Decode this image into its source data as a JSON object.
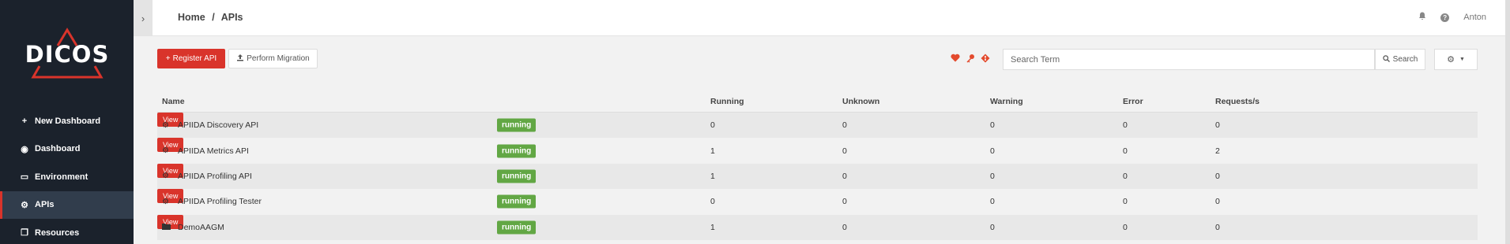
{
  "brand": {
    "name": "DICOS",
    "accent": "#d9342b"
  },
  "sidebar": {
    "items": [
      {
        "label": "New Dashboard",
        "icon": "plus-icon",
        "glyph": "+"
      },
      {
        "label": "Dashboard",
        "icon": "dashboard-icon",
        "glyph": "◉"
      },
      {
        "label": "Environment",
        "icon": "monitor-icon",
        "glyph": "▭"
      },
      {
        "label": "APIs",
        "icon": "cogs-icon",
        "glyph": "⚙"
      },
      {
        "label": "Resources",
        "icon": "copy-icon",
        "glyph": "❐"
      }
    ],
    "active_index": 3
  },
  "header": {
    "breadcrumb": {
      "home": "Home",
      "separator": "/",
      "current": "APIs"
    },
    "user": "Anton"
  },
  "toolbar": {
    "register_label": "Register API",
    "migration_label": "Perform Migration",
    "search_placeholder": "Search Term",
    "search_value": "",
    "search_label": "Search"
  },
  "table": {
    "headers": {
      "name": "Name",
      "running": "Running",
      "unknown": "Unknown",
      "warning": "Warning",
      "error": "Error",
      "requests": "Requests/s"
    },
    "rows": [
      {
        "name": "APIIDA Discovery API",
        "icon": "cogs-icon",
        "status": "running",
        "running": "0",
        "unknown": "0",
        "warning": "0",
        "error": "0",
        "requests": "0",
        "action": "View"
      },
      {
        "name": "APIIDA Metrics API",
        "icon": "cogs-icon",
        "status": "running",
        "running": "1",
        "unknown": "0",
        "warning": "0",
        "error": "0",
        "requests": "2",
        "action": "View"
      },
      {
        "name": "APIIDA Profiling API",
        "icon": "cogs-icon",
        "status": "running",
        "running": "1",
        "unknown": "0",
        "warning": "0",
        "error": "0",
        "requests": "0",
        "action": "View"
      },
      {
        "name": "APIIDA Profiling Tester",
        "icon": "cogs-icon",
        "status": "running",
        "running": "0",
        "unknown": "0",
        "warning": "0",
        "error": "0",
        "requests": "0",
        "action": "View"
      },
      {
        "name": "DemoAAGM",
        "icon": "folder-icon",
        "status": "running",
        "running": "1",
        "unknown": "0",
        "warning": "0",
        "error": "0",
        "requests": "0",
        "action": "View"
      }
    ]
  },
  "colors": {
    "sidebar_bg": "#1b222c",
    "status_green": "#62a744",
    "action_red": "#d9342b"
  }
}
